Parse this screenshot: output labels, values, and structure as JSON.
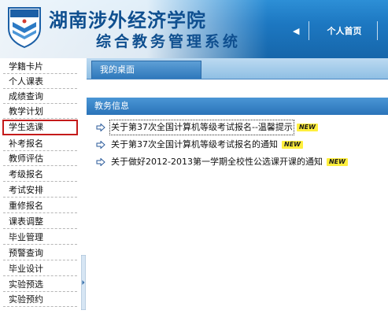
{
  "header": {
    "school_name": "湖南涉外经济学院",
    "system_name": "综合教务管理系统",
    "nav_arrow": "◀",
    "nav_home": "个人首页"
  },
  "sidebar": {
    "items": [
      {
        "label": "学籍卡片"
      },
      {
        "label": "个人课表"
      },
      {
        "label": "成绩查询"
      },
      {
        "label": "教学计划"
      },
      {
        "label": "学生选课",
        "selected": true
      },
      {
        "label": "补考报名"
      },
      {
        "label": "教师评估"
      },
      {
        "label": "考级报名"
      },
      {
        "label": "考试安排"
      },
      {
        "label": "重修报名"
      },
      {
        "label": "课表调整"
      },
      {
        "label": "毕业管理"
      },
      {
        "label": "预警查询"
      },
      {
        "label": "毕业设计"
      },
      {
        "label": "实验预选"
      },
      {
        "label": "实验预约"
      }
    ]
  },
  "main": {
    "tab_label": "我的桌面",
    "panel_title": "教务信息",
    "notices": [
      {
        "title": "关于第37次全国计算机等级考试报名--温馨提示",
        "badge": "NEW"
      },
      {
        "title": "关于第37次全国计算机等级考试报名的通知",
        "badge": "NEW"
      },
      {
        "title": "关于做好2012-2013第一学期全校性公选课开课的通知",
        "badge": "NEW"
      }
    ]
  },
  "colors": {
    "accent": "#1d78c2",
    "selected_outline": "#c41a1a",
    "new_badge": "#ffef3d"
  },
  "icons": {
    "logo": "school-crest-icon",
    "notice_bullet": "arrow-right-icon"
  }
}
